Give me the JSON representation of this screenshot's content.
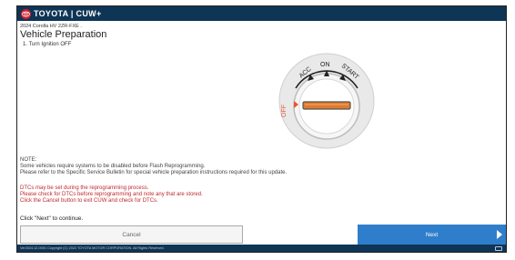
{
  "header": {
    "brand": "TOYOTA | CUW+",
    "logo_icon": "toyota-logo-icon"
  },
  "vehicle": "2024 Corolla HV 2ZR-FXE .",
  "page_title": "Vehicle Preparation",
  "step": "1. Turn Ignition OFF",
  "ignition_dial": {
    "labels": [
      "ACC",
      "ON",
      "START",
      "OFF"
    ],
    "current": "OFF",
    "colors": {
      "off_label": "#e8552e",
      "key_slot": "#e07a2d",
      "arrow": "#e8552e"
    }
  },
  "note": {
    "heading": "NOTE:",
    "lines": [
      "Some vehicles require systems to be disabled before Flash Reprogramming.",
      "Please refer to the Specific Service Bulletin for special vehicle preparation instructions required for this update."
    ]
  },
  "warning": {
    "color": "#c0282d",
    "lines": [
      "DTCs may be set during the reprogramming process.",
      "Please check for DTCs before reprogramming and note any that are stored.",
      "Click the Cancel button to exit CUW and check for DTCs."
    ]
  },
  "continue_text": "Click \"Next\" to continue.",
  "buttons": {
    "cancel": "Cancel",
    "next": "Next"
  },
  "footer": {
    "text": "Ver2024.12.0001 Copyright (C) 2022 TOYOTA MOTOR CORPORATION. All Rights Reserved."
  },
  "colors": {
    "header_bg": "#0f3556",
    "next_button": "#2f7ecb"
  }
}
